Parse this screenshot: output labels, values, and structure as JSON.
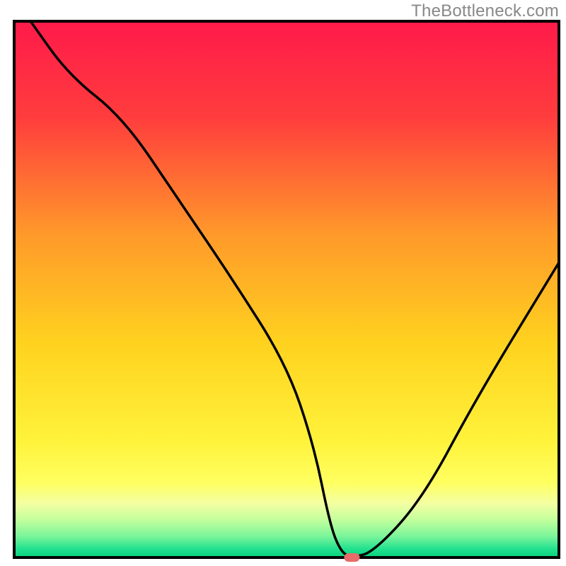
{
  "watermark": "TheBottleneck.com",
  "chart_data": {
    "type": "line",
    "title": "",
    "xlabel": "",
    "ylabel": "",
    "xlim": [
      0,
      100
    ],
    "ylim": [
      0,
      100
    ],
    "grid": false,
    "legend": false,
    "x": [
      3,
      10,
      20,
      30,
      40,
      50,
      55,
      58,
      60,
      62,
      66,
      75,
      85,
      100
    ],
    "values": [
      100,
      90,
      82,
      67,
      52,
      36,
      21,
      6,
      1,
      0,
      1,
      11,
      30,
      55
    ],
    "optimum_point": {
      "x": 62,
      "y": 0
    },
    "background_gradient": {
      "stops": [
        {
          "offset": 0.0,
          "color": "#ff1a4a"
        },
        {
          "offset": 0.18,
          "color": "#ff3d3d"
        },
        {
          "offset": 0.4,
          "color": "#ff9a2a"
        },
        {
          "offset": 0.6,
          "color": "#ffd21f"
        },
        {
          "offset": 0.78,
          "color": "#fff23a"
        },
        {
          "offset": 0.86,
          "color": "#ffff60"
        },
        {
          "offset": 0.9,
          "color": "#f3ffa3"
        },
        {
          "offset": 0.93,
          "color": "#c2ff9c"
        },
        {
          "offset": 0.96,
          "color": "#7cf59b"
        },
        {
          "offset": 0.985,
          "color": "#1fe08e"
        },
        {
          "offset": 1.0,
          "color": "#09d07c"
        }
      ]
    },
    "border_color": "#000000"
  }
}
